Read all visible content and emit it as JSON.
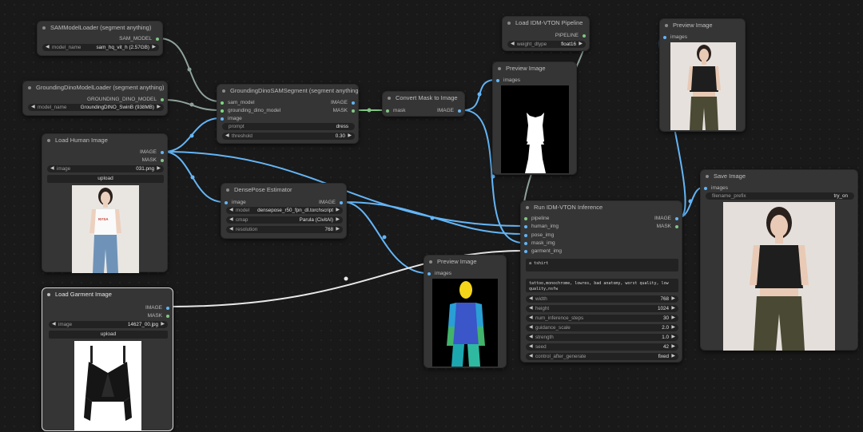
{
  "nodes": {
    "sam_loader": {
      "title": "SAMModelLoader (segment anything)",
      "outputs": [
        "SAM_MODEL"
      ],
      "widgets": [
        {
          "label": "model_name",
          "value": "sam_hq_vit_h (2.57GB)"
        }
      ]
    },
    "grounding_loader": {
      "title": "GroundingDinoModelLoader (segment anything)",
      "outputs": [
        "GROUNDING_DINO_MODEL"
      ],
      "widgets": [
        {
          "label": "model_name",
          "value": "GroundingDINO_SwinB (938MB)"
        }
      ]
    },
    "sam_segment": {
      "title": "GroundingDinoSAMSegment (segment anything)",
      "inputs": [
        "sam_model",
        "grounding_dino_model",
        "image"
      ],
      "outputs": [
        "IMAGE",
        "MASK"
      ],
      "widgets": [
        {
          "label": "prompt",
          "value": "dress"
        },
        {
          "label": "threshold",
          "value": "0.30"
        }
      ]
    },
    "convert_mask": {
      "title": "Convert Mask to Image",
      "inputs": [
        "mask"
      ],
      "outputs": [
        "IMAGE"
      ]
    },
    "load_pipeline": {
      "title": "Load IDM-VTON Pipeline",
      "outputs": [
        "PIPELINE"
      ],
      "widgets": [
        {
          "label": "weight_dtype",
          "value": "float16"
        }
      ]
    },
    "preview_mask": {
      "title": "Preview Image",
      "inputs": [
        "images"
      ]
    },
    "preview_top": {
      "title": "Preview Image",
      "inputs": [
        "images"
      ]
    },
    "load_human": {
      "title": "Load Human Image",
      "outputs": [
        "IMAGE",
        "MASK"
      ],
      "widgets": [
        {
          "label": "image",
          "value": "031.png"
        }
      ],
      "button": "upload"
    },
    "densepose": {
      "title": "DensePose Estimator",
      "inputs": [
        "image"
      ],
      "outputs": [
        "IMAGE"
      ],
      "widgets": [
        {
          "label": "model",
          "value": "densepose_r50_fpn_dl.torchscript"
        },
        {
          "label": "cmap",
          "value": "Parula (CivitAI)"
        },
        {
          "label": "resolution",
          "value": "768"
        }
      ]
    },
    "run_vton": {
      "title": "Run IDM-VTON Inference",
      "inputs": [
        "pipeline",
        "human_img",
        "pose_img",
        "mask_img",
        "garment_img"
      ],
      "outputs": [
        "IMAGE",
        "MASK"
      ],
      "text_prompt": "a tshirt",
      "negative_prompt": "tattoo,monochrome, lowres, bad anatomy, worst quality, low quality,nsfw",
      "widgets": [
        {
          "label": "width",
          "value": "768"
        },
        {
          "label": "height",
          "value": "1024"
        },
        {
          "label": "num_inference_steps",
          "value": "30"
        },
        {
          "label": "guidance_scale",
          "value": "2.0"
        },
        {
          "label": "strength",
          "value": "1.0"
        },
        {
          "label": "seed",
          "value": "42"
        },
        {
          "label": "control_after_generate",
          "value": "fixed"
        }
      ]
    },
    "save_image": {
      "title": "Save Image",
      "inputs": [
        "images"
      ],
      "widgets": [
        {
          "label": "filename_prefix",
          "value": "try_on"
        }
      ]
    },
    "preview_pose": {
      "title": "Preview Image",
      "inputs": [
        "images"
      ]
    },
    "load_garment": {
      "title": "Load Garment Image",
      "outputs": [
        "IMAGE",
        "MASK"
      ],
      "widgets": [
        {
          "label": "image",
          "value": "14627_00.jpg"
        }
      ],
      "button": "upload"
    }
  },
  "photo_text": {
    "shirt_print": "NYSA"
  },
  "colors": {
    "canvas": "#191919",
    "node_bg": "#353535",
    "image_link": "#64b5f6",
    "mask_link": "#81c784",
    "model_link": "#8fa29a",
    "selected_link": "#e8e8e8"
  }
}
